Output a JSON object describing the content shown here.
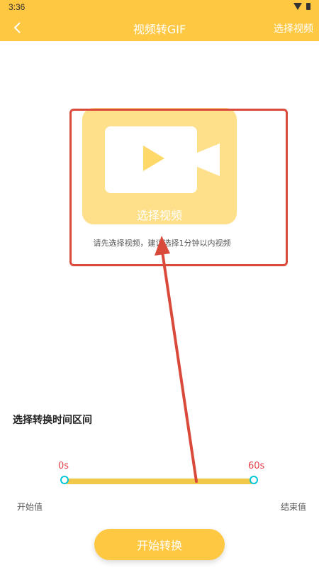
{
  "status": {
    "time": "3:36"
  },
  "header": {
    "title": "视频转GIF",
    "action_label": "选择视频",
    "bg_color": "#FFC843"
  },
  "picker": {
    "card_label": "选择视频",
    "hint": "请先选择视频，建议选择1分钟以内视频",
    "icon": "video-camera-icon",
    "annotation_color": "#D94A3A"
  },
  "range": {
    "section_title": "选择转换时间区间",
    "start_value": "0s",
    "end_value": "60s",
    "start_label": "开始值",
    "end_label": "结束值",
    "value_color": "#E5424D"
  },
  "footer": {
    "start_button": "开始转换"
  }
}
